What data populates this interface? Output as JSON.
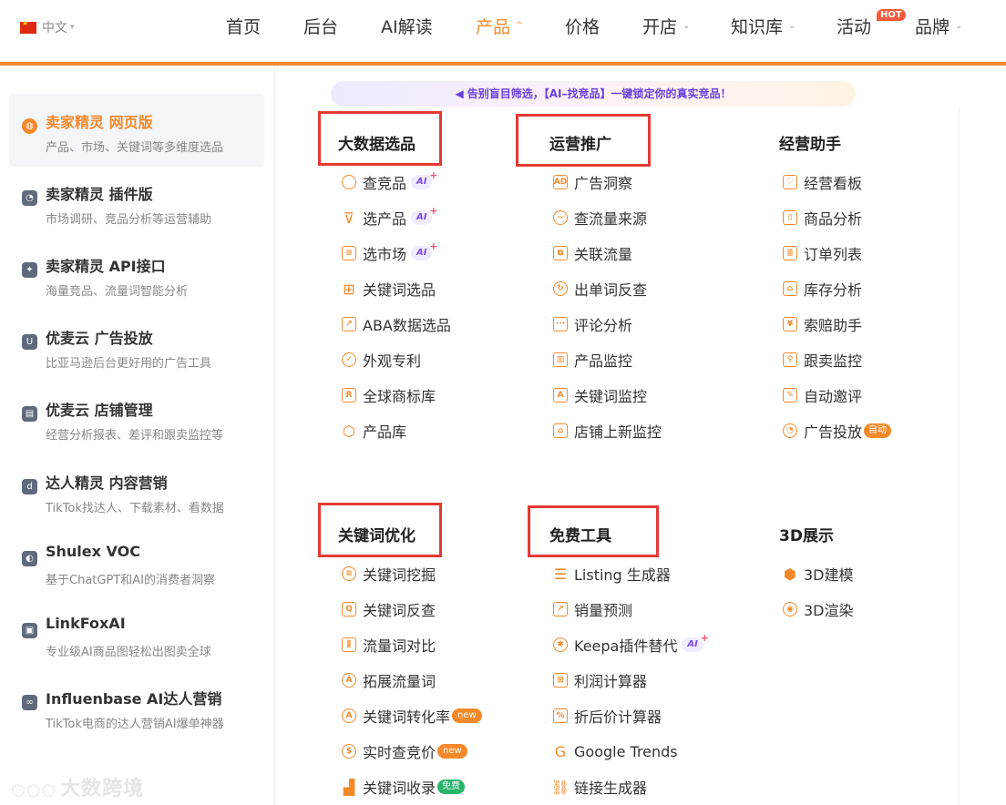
{
  "colors": {
    "accent": "#f5892a",
    "highlight_box": "#e53935",
    "ai_purple": "#7b4bf0",
    "free_green": "#27b36a"
  },
  "topnav": {
    "language": "中文",
    "items": [
      "首页",
      "后台",
      "AI解读",
      "产品",
      "价格",
      "开店",
      "知识库",
      "活动",
      "品牌"
    ],
    "active": "产品",
    "hot_badge": "HOT"
  },
  "sidebar": {
    "items": [
      {
        "title": "卖家精灵 网页版",
        "desc": "产品、市场、关键词等多维度选品",
        "icon": "globe-icon"
      },
      {
        "title": "卖家精灵 插件版",
        "desc": "市场调研、竞品分析等运营辅助",
        "icon": "plugin-icon"
      },
      {
        "title": "卖家精灵 API接口",
        "desc": "海量竞品、流量词智能分析",
        "icon": "api-icon"
      },
      {
        "title": "优麦云 广告投放",
        "desc": "比亚马逊后台更好用的广告工具",
        "icon": "umy-ad-icon"
      },
      {
        "title": "优麦云 店铺管理",
        "desc": "经营分析报表、差评和跟卖监控等",
        "icon": "store-icon"
      },
      {
        "title": "达人精灵 内容营销",
        "desc": "TikTok找达人、下载素材、看数据",
        "icon": "influencer-icon"
      },
      {
        "title": "Shulex VOC",
        "desc": "基于ChatGPT和AI的消费者洞察",
        "icon": "voc-icon"
      },
      {
        "title": "LinkFoxAI",
        "desc": "专业级AI商品图轻松出图卖全球",
        "icon": "image-icon"
      },
      {
        "title": "Influenbase AI达人营销",
        "desc": "TikTok电商的达人营销AI爆单神器",
        "icon": "link-icon"
      }
    ],
    "watermark": "大数跨境"
  },
  "banner": {
    "text": "告别盲目筛选，【AI–找竞品】一键锁定你的真实竞品！",
    "icon": "megaphone-icon"
  },
  "sections": {
    "big_data": {
      "title": "大数据选品",
      "items": [
        {
          "label": "查竞品",
          "icon": "search-icon",
          "badge": "AI"
        },
        {
          "label": "选产品",
          "icon": "filter-icon",
          "badge": "AI"
        },
        {
          "label": "选市场",
          "icon": "market-icon",
          "badge": "AI"
        },
        {
          "label": "关键词选品",
          "icon": "grid-icon"
        },
        {
          "label": "ABA数据选品",
          "icon": "chart-icon"
        },
        {
          "label": "外观专利",
          "icon": "patent-icon"
        },
        {
          "label": "全球商标库",
          "icon": "trademark-icon"
        },
        {
          "label": "产品库",
          "icon": "box-icon"
        }
      ]
    },
    "operations": {
      "title": "运营推广",
      "items": [
        {
          "label": "广告洞察",
          "icon": "ad-icon"
        },
        {
          "label": "查流量来源",
          "icon": "traffic-icon"
        },
        {
          "label": "关联流量",
          "icon": "related-icon"
        },
        {
          "label": "出单词反查",
          "icon": "reverse-icon"
        },
        {
          "label": "评论分析",
          "icon": "comment-icon"
        },
        {
          "label": "产品监控",
          "icon": "monitor-icon"
        },
        {
          "label": "关键词监控",
          "icon": "keyword-monitor-icon"
        },
        {
          "label": "店铺上新监控",
          "icon": "shop-icon"
        }
      ]
    },
    "assistant": {
      "title": "经营助手",
      "items": [
        {
          "label": "经营看板",
          "icon": "dashboard-icon"
        },
        {
          "label": "商品分析",
          "icon": "product-analysis-icon"
        },
        {
          "label": "订单列表",
          "icon": "order-icon"
        },
        {
          "label": "库存分析",
          "icon": "inventory-icon"
        },
        {
          "label": "索赔助手",
          "icon": "claim-icon"
        },
        {
          "label": "跟卖监控",
          "icon": "follow-sell-icon"
        },
        {
          "label": "自动邀评",
          "icon": "review-request-icon"
        },
        {
          "label": "广告投放",
          "icon": "pie-icon",
          "badge": "自动"
        }
      ]
    },
    "keyword_opt": {
      "title": "关键词优化",
      "items": [
        {
          "label": "关键词挖掘",
          "icon": "database-icon"
        },
        {
          "label": "关键词反查",
          "icon": "keyword-reverse-icon"
        },
        {
          "label": "流量词对比",
          "icon": "compare-icon"
        },
        {
          "label": "拓展流量词",
          "icon": "expand-icon"
        },
        {
          "label": "关键词转化率",
          "icon": "conversion-icon",
          "badge": "new"
        },
        {
          "label": "实时查竞价",
          "icon": "bid-icon",
          "badge": "new"
        },
        {
          "label": "关键词收录",
          "icon": "index-icon",
          "badge": "免费"
        }
      ]
    },
    "free_tools": {
      "title": "免费工具",
      "items": [
        {
          "label": "Listing 生成器",
          "icon": "list-icon"
        },
        {
          "label": "销量预测",
          "icon": "forecast-icon"
        },
        {
          "label": "Keepa插件替代",
          "icon": "keepa-icon",
          "badge": "AI"
        },
        {
          "label": "利润计算器",
          "icon": "calculator-icon"
        },
        {
          "label": "折后价计算器",
          "icon": "discount-calc-icon"
        },
        {
          "label": "Google Trends",
          "icon": "google-icon"
        },
        {
          "label": "链接生成器",
          "icon": "chain-icon"
        }
      ]
    },
    "three_d": {
      "title": "3D展示",
      "items": [
        {
          "label": "3D建模",
          "icon": "cube-icon"
        },
        {
          "label": "3D渲染",
          "icon": "render-icon"
        }
      ]
    }
  }
}
